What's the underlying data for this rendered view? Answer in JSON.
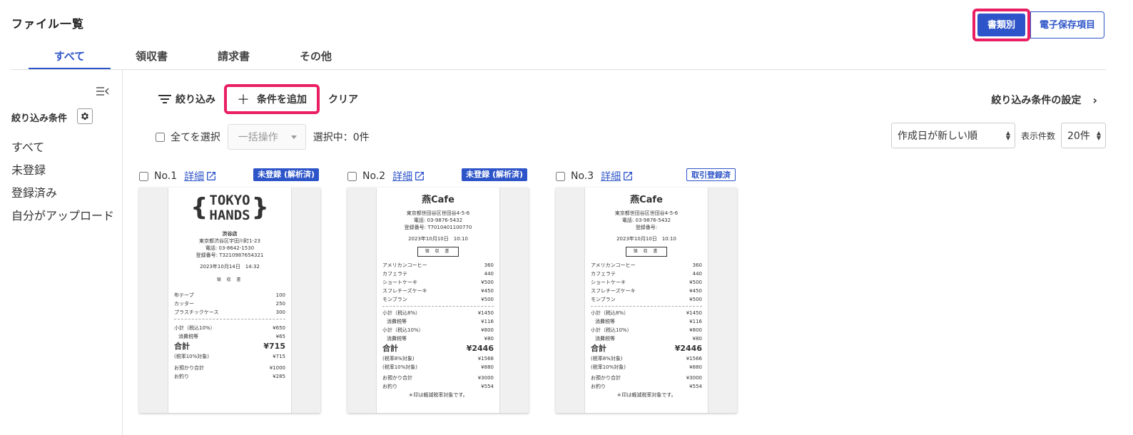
{
  "header": {
    "title": "ファイル一覧",
    "view_by_type": "書類別",
    "view_by_item": "電子保存項目"
  },
  "tabs": [
    "すべて",
    "領収書",
    "請求書",
    "その他"
  ],
  "sidebar": {
    "title": "絞り込み条件",
    "items": [
      "すべて",
      "未登録",
      "登録済み",
      "自分がアップロード"
    ]
  },
  "filterbar": {
    "filter_label": "絞り込み",
    "add_condition": "条件を追加",
    "clear": "クリア",
    "settings": "絞り込み条件の設定"
  },
  "selection": {
    "select_all": "全てを選択",
    "bulk_placeholder": "一括操作",
    "selected_count": "選択中：0件"
  },
  "sort": {
    "value": "作成日が新しい順",
    "count_label": "表示件数",
    "count_value": "20件"
  },
  "colors": {
    "accent": "#2d54c8",
    "highlight": "#e91e63"
  },
  "cards": [
    {
      "no": "No.1",
      "detail": "詳細",
      "badge": "未登録 (解析済)",
      "receipt": {
        "logo_top": "TOKYO",
        "logo_bottom": "HANDS",
        "store": "渋谷店",
        "address": "東京都渋谷区宇田川町1-23",
        "tel": "電話: 03-8642-1530",
        "reg": "登録番号: T3210987654321",
        "date": "2023年10月14日　14:32",
        "doc_title": "領 収 書",
        "items": [
          {
            "name": "布テープ",
            "price": "100"
          },
          {
            "name": "カッター",
            "price": "250"
          },
          {
            "name": "プラスチックケース",
            "price": "300"
          }
        ],
        "subtotal": {
          "name": "小計（税込10%）",
          "price": "¥650"
        },
        "tax": {
          "name": "消費税等",
          "price": "¥65"
        },
        "total": {
          "name": "合計",
          "price": "¥715"
        },
        "taxable": {
          "name": "(税率10%対象)",
          "price": "¥715"
        },
        "paid": {
          "name": "お預かり合計",
          "price": "¥1000"
        },
        "change": {
          "name": "お釣り",
          "price": "¥285"
        }
      }
    },
    {
      "no": "No.2",
      "detail": "詳細",
      "badge": "未登録 (解析済)",
      "receipt": {
        "name": "燕Cafe",
        "address": "東京都世田谷区世田谷4-5-6",
        "tel": "電話: 03-9876-5432",
        "reg": "登録番号: T7010401100770",
        "date": "2023年10月10日　10:10",
        "doc_title": "領 収 書",
        "items": [
          {
            "name": "アメリカンコーヒー",
            "price": "360"
          },
          {
            "name": "カフェラテ",
            "price": "440"
          },
          {
            "name": "ショートケーキ",
            "price": "¥500"
          },
          {
            "name": "スフレチーズケーキ",
            "price": "¥450"
          },
          {
            "name": "モンブラン",
            "price": "¥500"
          }
        ],
        "sub8": {
          "name": "小計（税込8%）",
          "price": "¥1450"
        },
        "tax8": {
          "name": "消費税等",
          "price": "¥116"
        },
        "sub10": {
          "name": "小計（税込10%）",
          "price": "¥800"
        },
        "tax10": {
          "name": "消費税等",
          "price": "¥80"
        },
        "total": {
          "name": "合計",
          "price": "¥2446"
        },
        "taxable8": {
          "name": "(税率8%対象)",
          "price": "¥1566"
        },
        "taxable10": {
          "name": "(税率10%対象)",
          "price": "¥880"
        },
        "paid": {
          "name": "お預かり合計",
          "price": "¥3000"
        },
        "change": {
          "name": "お釣り",
          "price": "¥554"
        },
        "note": "＊印は軽減税率対象です。"
      }
    },
    {
      "no": "No.3",
      "detail": "詳細",
      "badge": "取引登録済",
      "receipt": {
        "name": "燕Cafe",
        "address": "東京都世田谷区世田谷4-5-6",
        "tel": "電話: 03-9876-5432",
        "reg": "登録番号:",
        "date": "2023年10月10日　10:10",
        "doc_title": "領 収 書",
        "items": [
          {
            "name": "アメリカンコーヒー",
            "price": "360"
          },
          {
            "name": "カフェラテ",
            "price": "440"
          },
          {
            "name": "ショートケーキ",
            "price": "¥500"
          },
          {
            "name": "スフレチーズケーキ",
            "price": "¥450"
          },
          {
            "name": "モンブラン",
            "price": "¥500"
          }
        ],
        "sub8": {
          "name": "小計（税込8%）",
          "price": "¥1450"
        },
        "tax8": {
          "name": "消費税等",
          "price": "¥116"
        },
        "sub10": {
          "name": "小計（税込10%）",
          "price": "¥800"
        },
        "tax10": {
          "name": "消費税等",
          "price": "¥80"
        },
        "total": {
          "name": "合計",
          "price": "¥2446"
        },
        "taxable8": {
          "name": "(税率8%対象)",
          "price": "¥1566"
        },
        "taxable10": {
          "name": "(税率10%対象)",
          "price": "¥880"
        },
        "paid": {
          "name": "お預かり合計",
          "price": "¥3000"
        },
        "change": {
          "name": "お釣り",
          "price": "¥554"
        },
        "note": "＊印は軽減税率対象です。"
      }
    }
  ]
}
